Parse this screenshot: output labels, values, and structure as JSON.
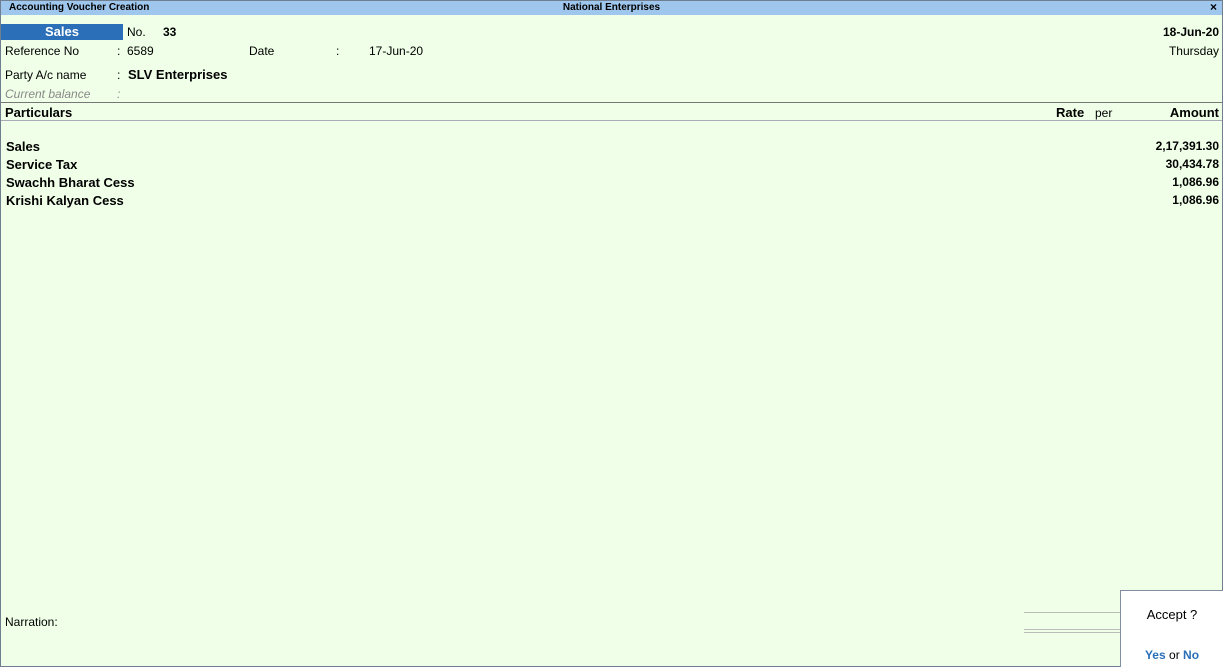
{
  "titlebar": {
    "left": "Accounting Voucher Creation",
    "center": "National Enterprises",
    "close": "×"
  },
  "voucher": {
    "type": "Sales",
    "no_label": "No.",
    "no_value": "33",
    "date": "18-Jun-20",
    "day": "Thursday"
  },
  "reference": {
    "label": "Reference No",
    "colon": ":",
    "value": "6589",
    "date_label": "Date",
    "date_colon": ":",
    "date_value": "17-Jun-20"
  },
  "party": {
    "label": "Party A/c name",
    "colon": ":",
    "value": "SLV Enterprises",
    "balance_label": "Current balance",
    "balance_colon": ":"
  },
  "table": {
    "headers": {
      "particulars": "Particulars",
      "rate": "Rate",
      "per": "per",
      "amount": "Amount"
    },
    "rows": [
      {
        "particulars": "Sales",
        "amount": "2,17,391.30"
      },
      {
        "particulars": "Service Tax",
        "amount": "30,434.78"
      },
      {
        "particulars": "Swachh Bharat Cess",
        "amount": "1,086.96"
      },
      {
        "particulars": "Krishi Kalyan Cess",
        "amount": "1,086.96"
      }
    ]
  },
  "narration": {
    "label": "Narration:"
  },
  "accept": {
    "question": "Accept ?",
    "yes": "Yes",
    "or": "or",
    "no": "No"
  }
}
